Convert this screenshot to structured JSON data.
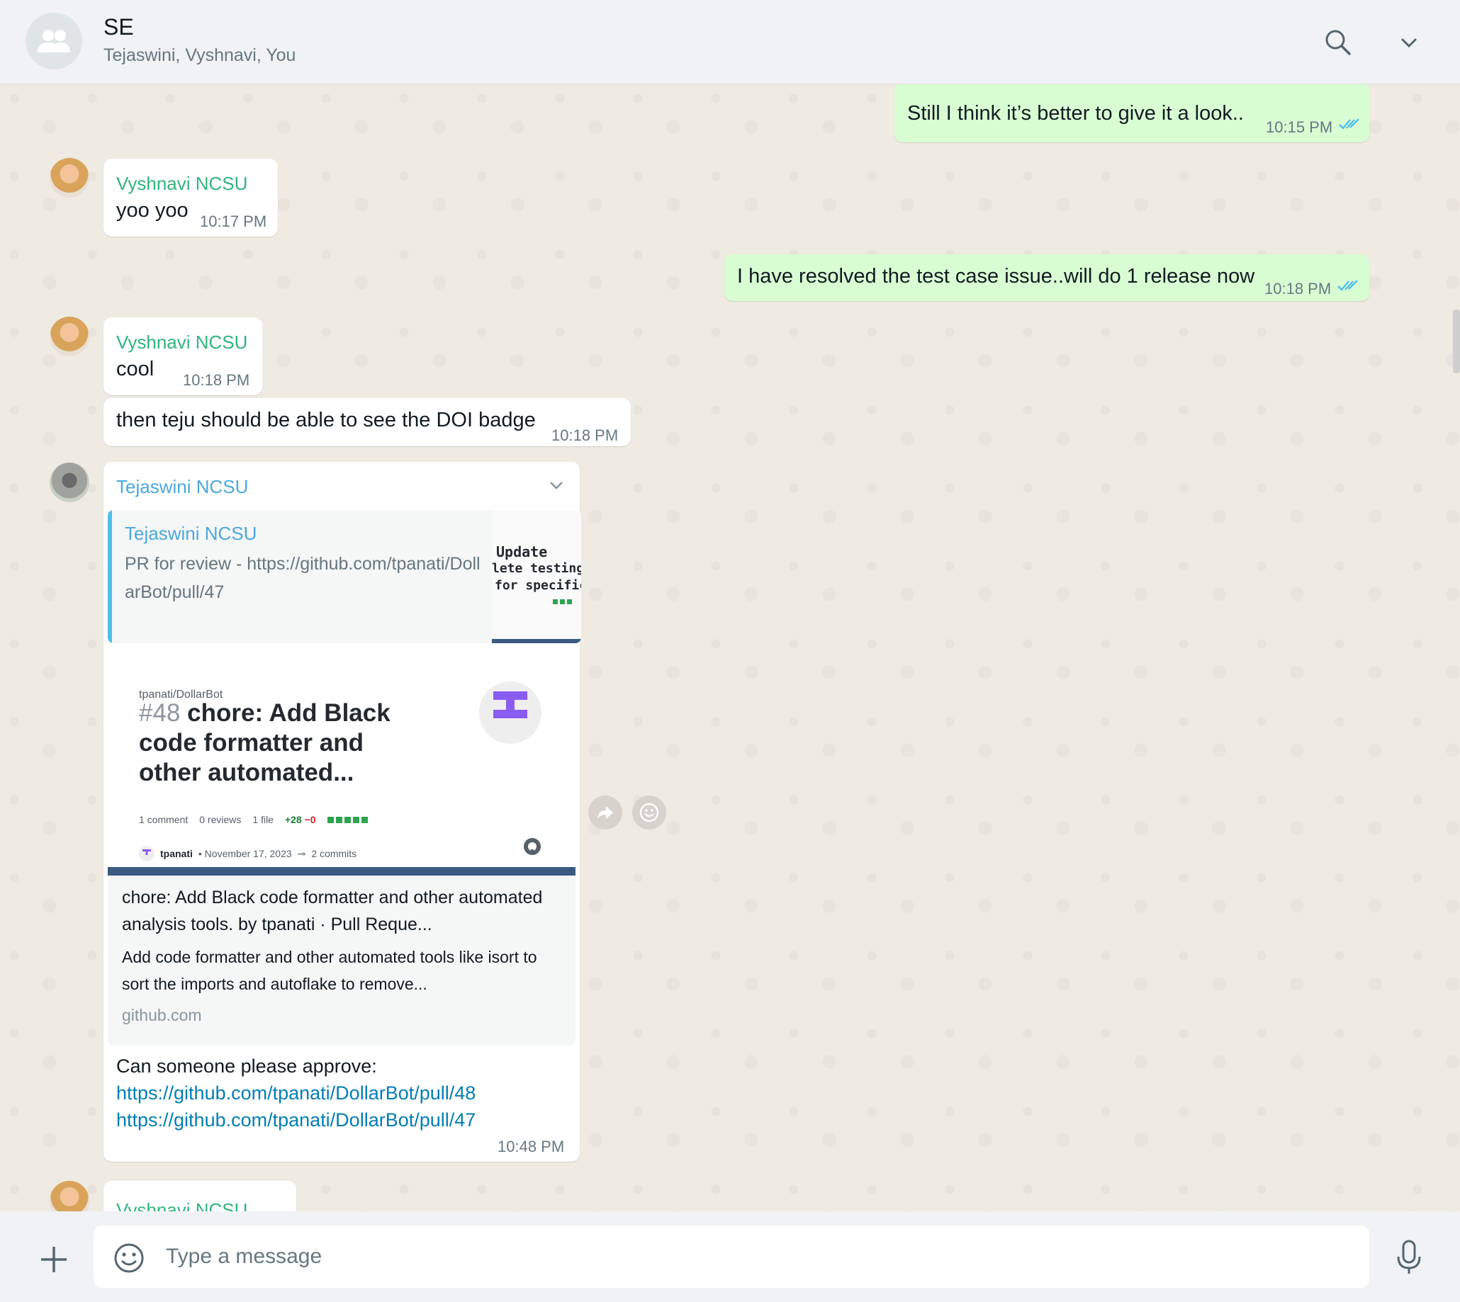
{
  "header": {
    "title": "SE",
    "subtitle": "Tejaswini, Vyshnavi, You"
  },
  "messages": {
    "m1": {
      "text": "Still I think it’s better to give it a look..",
      "time": "10:15 PM"
    },
    "m2": {
      "sender": "Vyshnavi NCSU",
      "text": "yoo yoo",
      "time": "10:17 PM"
    },
    "m3": {
      "text": "I have resolved the test case issue..will do 1 release now",
      "time": "10:18 PM"
    },
    "m4": {
      "sender": "Vyshnavi NCSU",
      "text": "cool",
      "time": "10:18 PM"
    },
    "m5": {
      "text": "then teju should be able to see the DOI badge",
      "time": "10:18 PM"
    },
    "m6": {
      "sender": "Tejaswini NCSU",
      "quote": {
        "sender": "Tejaswini NCSU",
        "text": "PR for review - https://github.com/tpanati/DollarBot/pull/47",
        "thumb_lines": [
          "Update",
          "lete testing",
          "for specific"
        ]
      },
      "preview": {
        "repo": "tpanati/DollarBot",
        "pr_number": "#48",
        "pr_title": "chore: Add Black code formatter and other automated...",
        "comments": "1 comment",
        "reviews": "0 reviews",
        "files": "1 file",
        "additions": "+28",
        "deletions": "−0",
        "author": "tpanati",
        "date": "• November 17, 2023",
        "commits": "2 commits",
        "title": "chore: Add Black code formatter and other automated analysis tools. by tpanati · Pull Reque...",
        "description": "Add code formatter and other automated tools like isort to sort the imports and autoflake to remove...",
        "domain": "github.com"
      },
      "text": "Can someone please approve:",
      "links": [
        "https://github.com/tpanati/DollarBot/pull/48",
        "https://github.com/tpanati/DollarBot/pull/47"
      ],
      "time": "10:48 PM"
    },
    "m7": {
      "sender": "Vyshnavi NCSU"
    }
  },
  "composer": {
    "placeholder": "Type a message"
  },
  "colors": {
    "outgoing_bubble": "#d9fdd3",
    "incoming_bubble": "#ffffff",
    "vyshnavi_name": "#31b57e",
    "tejaswini_name": "#4aa9dc",
    "link": "#027eb5",
    "read_ticks": "#53bdeb"
  },
  "icons": [
    "group-avatar-icon",
    "search-icon",
    "chevron-down-icon",
    "double-check-icon",
    "forward-icon",
    "emoji-reaction-icon",
    "github-icon",
    "plus-icon",
    "emoji-icon",
    "mic-icon"
  ]
}
